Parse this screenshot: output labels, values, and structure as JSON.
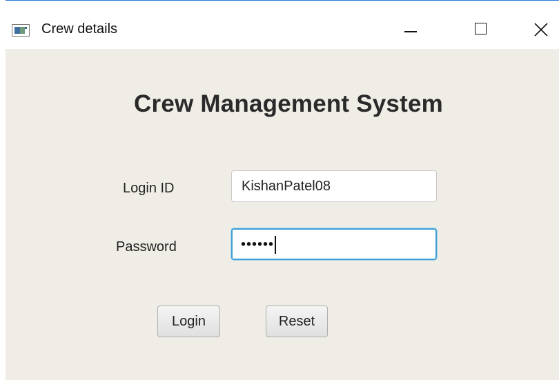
{
  "window": {
    "title": "Crew details",
    "icon": "app-window-icon",
    "controls": {
      "minimize_icon": "minimize-icon",
      "maximize_icon": "maximize-icon",
      "close_icon": "close-icon"
    }
  },
  "form": {
    "heading": "Crew Management System",
    "login_label": "Login ID",
    "login_value": "KishanPatel08",
    "password_label": "Password",
    "password_mask": "••••••"
  },
  "buttons": {
    "login_label": "Login",
    "reset_label": "Reset"
  },
  "colors": {
    "content_background": "#f0ede6",
    "focus_border": "#3e9fd6",
    "title_accent": "#2b79d6"
  }
}
